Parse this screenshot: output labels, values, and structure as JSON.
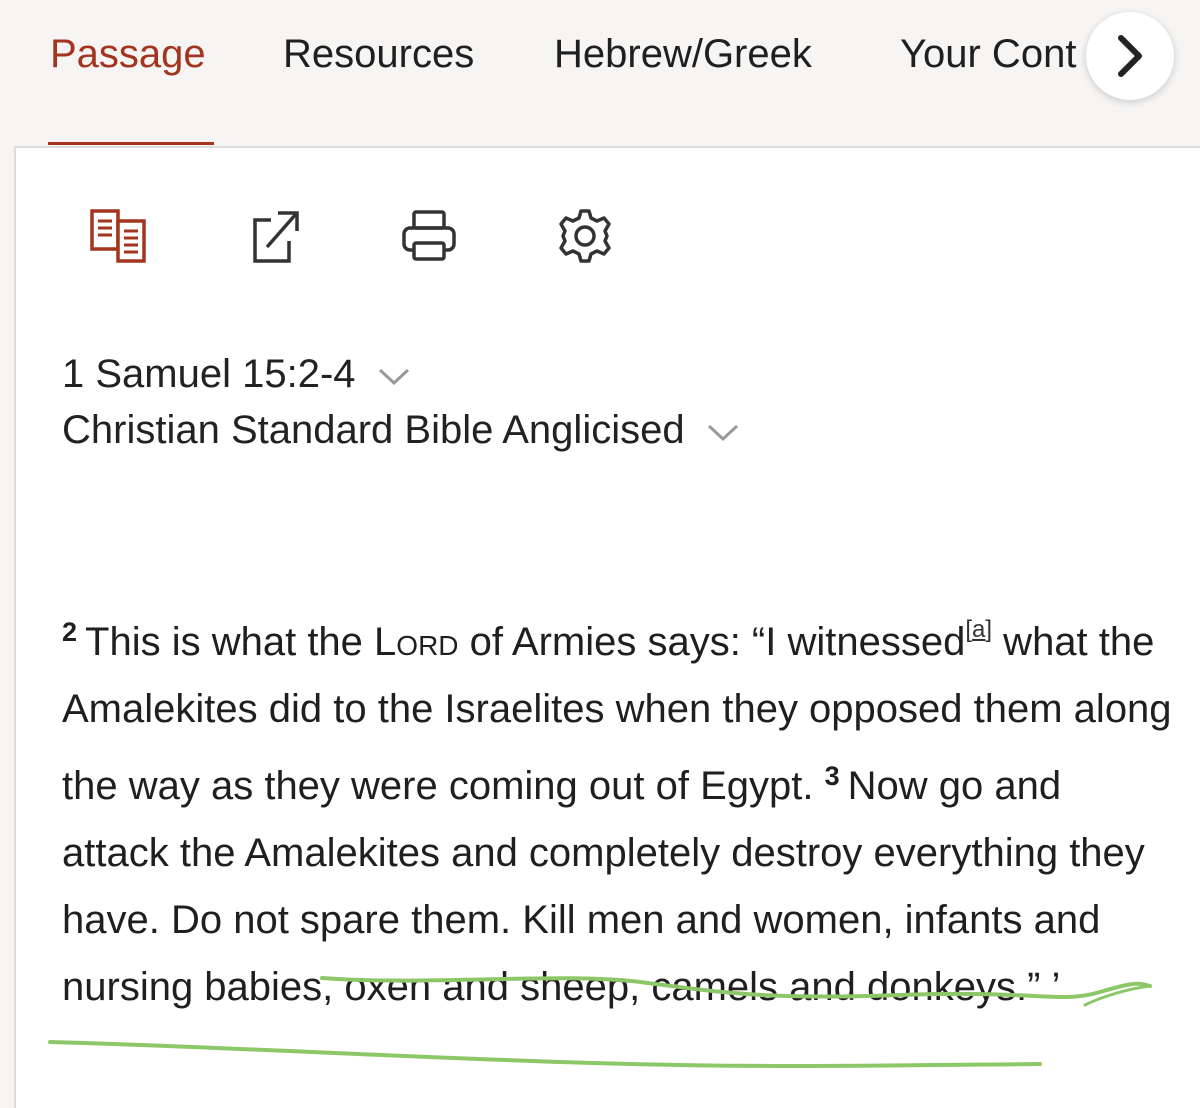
{
  "tabs": [
    {
      "label": "Passage",
      "active": true
    },
    {
      "label": "Resources",
      "active": false
    },
    {
      "label": "Hebrew/Greek",
      "active": false
    },
    {
      "label": "Your Cont",
      "active": false
    }
  ],
  "toolbar": {
    "icons": [
      "parallel-view-icon",
      "share-icon",
      "print-icon",
      "settings-icon"
    ]
  },
  "passage": {
    "reference": "1 Samuel 15:2-4",
    "version": "Christian Standard Bible Anglicised",
    "verse2_num": "2",
    "verse2_a": "This is what the ",
    "verse2_lord": "Lord",
    "verse2_b": " of Armies says: “I witnessed",
    "footnote": "a",
    "verse2_c": " what the Amalekites did to the Israelites when they opposed them along the way as they were coming out of Egypt. ",
    "verse3_num": "3",
    "verse3_a": "Now go and attack the Amalekites and completely destroy everything they have. Do not spare them. ",
    "verse3_highlight": "Kill men and women, infants and nursing babies, oxen and sheep, camels and donkeys.” ’"
  },
  "colors": {
    "accent": "#a3341e",
    "highlight_stroke": "#8cc868",
    "background": "#f6f5f4",
    "panel": "#ffffff"
  }
}
